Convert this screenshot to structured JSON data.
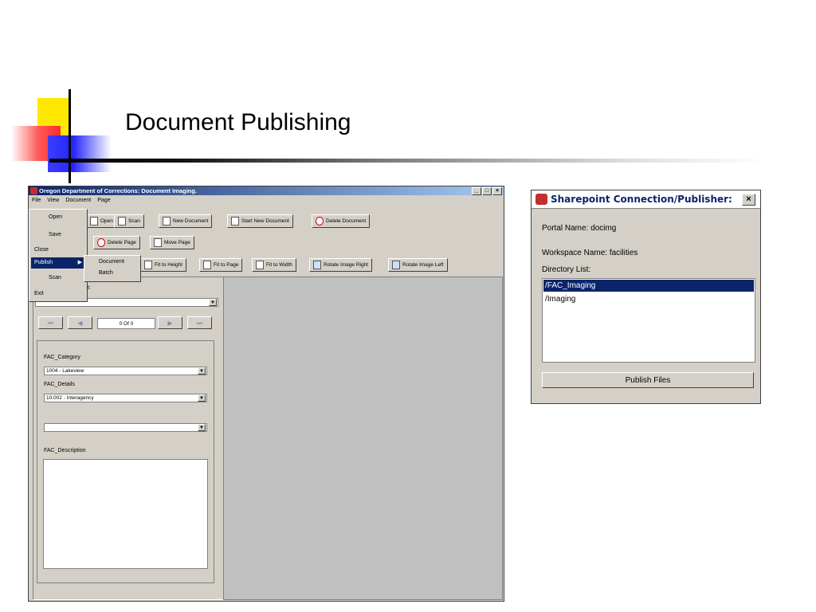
{
  "slide": {
    "title": "Document Publishing"
  },
  "app": {
    "title": "Oregon Department of Corrections: Document Imaging.",
    "window_buttons": [
      "_",
      "□",
      "×"
    ],
    "menu": [
      "File",
      "View",
      "Document",
      "Page"
    ],
    "toolbar1": [
      "Open",
      "Scan",
      "New Document",
      "Start New Document",
      "Delete Document"
    ],
    "toolbar2": [
      "Delete Page",
      "Move Page"
    ],
    "toolbar3": [
      "Fit to Height",
      "Fit to Page",
      "Fit to Width",
      "Rotate Image Right",
      "Rotate Image Left"
    ],
    "partial_label": "t:",
    "pager": {
      "text": "0 Of 0"
    },
    "fields": {
      "category_label": "FAC_Category",
      "category_value": "1004 - Lakeview",
      "details_label": "FAC_Details",
      "details_value": "10.002 - Interagency",
      "third_value": "",
      "description_label": "FAC_Description"
    }
  },
  "file_menu": {
    "items": [
      "Open",
      "Save",
      "Close",
      "Publish",
      "Scan",
      "Exit"
    ],
    "submenu": [
      "Document",
      "Batch"
    ]
  },
  "dialog": {
    "title": "Sharepoint Connection/Publisher:",
    "portal": "Portal Name: docimg",
    "workspace": "Workspace Name: facilities",
    "dir_label": "Directory List:",
    "directories": [
      "/FAC_Imaging",
      "/Imaging"
    ],
    "publish_button": "Publish Files",
    "close": "×"
  }
}
